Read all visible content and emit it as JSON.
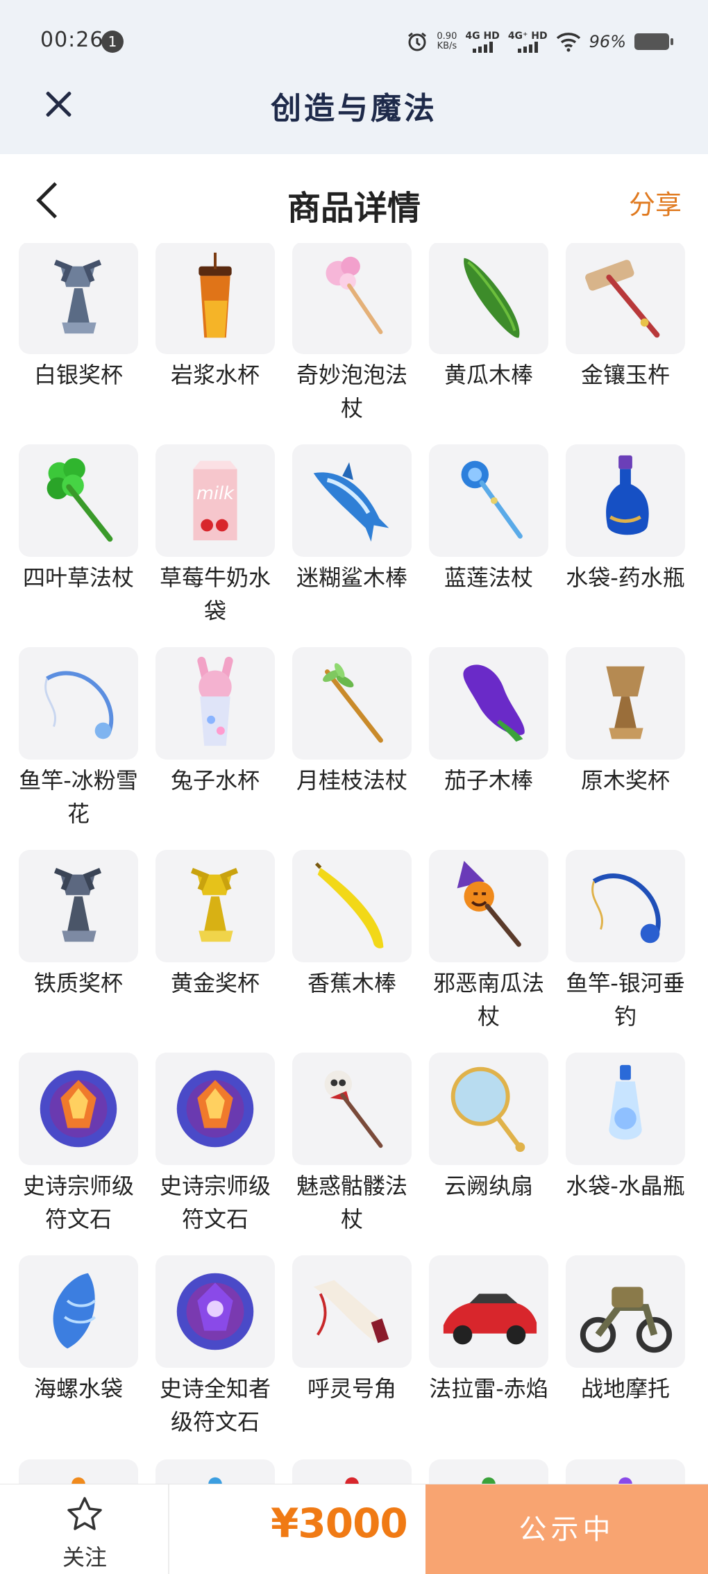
{
  "status_bar": {
    "time": "00:26",
    "notification_count": "1",
    "net_speed_value": "0.90",
    "net_speed_unit": "KB/s",
    "sim1": "4G HD",
    "sim2": "4G⁺ HD",
    "battery": "96%"
  },
  "app": {
    "title": "创造与魔法"
  },
  "header": {
    "title": "商品详情",
    "share_label": "分享"
  },
  "items": [
    {
      "name": "白银奖杯",
      "icon": "trophy-silver"
    },
    {
      "name": "岩浆水杯",
      "icon": "cup-lava"
    },
    {
      "name": "奇妙泡泡法杖",
      "icon": "wand-bubble"
    },
    {
      "name": "黄瓜木棒",
      "icon": "cucumber"
    },
    {
      "name": "金镶玉杵",
      "icon": "hammer"
    },
    {
      "name": "四叶草法杖",
      "icon": "clover-wand"
    },
    {
      "name": "草莓牛奶水袋",
      "icon": "milk-bag"
    },
    {
      "name": "迷糊鲨木棒",
      "icon": "shark"
    },
    {
      "name": "蓝莲法杖",
      "icon": "lotus-wand"
    },
    {
      "name": "水袋-药水瓶",
      "icon": "potion-blue"
    },
    {
      "name": "鱼竿-冰粉雪花",
      "icon": "rod-ice"
    },
    {
      "name": "兔子水杯",
      "icon": "cup-rabbit"
    },
    {
      "name": "月桂枝法杖",
      "icon": "laurel-wand"
    },
    {
      "name": "茄子木棒",
      "icon": "eggplant"
    },
    {
      "name": "原木奖杯",
      "icon": "trophy-wood"
    },
    {
      "name": "铁质奖杯",
      "icon": "trophy-iron"
    },
    {
      "name": "黄金奖杯",
      "icon": "trophy-gold"
    },
    {
      "name": "香蕉木棒",
      "icon": "banana"
    },
    {
      "name": "邪恶南瓜法杖",
      "icon": "pumpkin-wand"
    },
    {
      "name": "鱼竿-银河垂钓",
      "icon": "rod-galaxy"
    },
    {
      "name": "史诗宗师级符文石",
      "icon": "rune-orange"
    },
    {
      "name": "史诗宗师级符文石",
      "icon": "rune-orange"
    },
    {
      "name": "魅惑骷髅法杖",
      "icon": "skull-wand"
    },
    {
      "name": "云阙纨扇",
      "icon": "fan"
    },
    {
      "name": "水袋-水晶瓶",
      "icon": "crystal-bottle"
    },
    {
      "name": "海螺水袋",
      "icon": "conch"
    },
    {
      "name": "史诗全知者级符文石",
      "icon": "rune-purple"
    },
    {
      "name": "呼灵号角",
      "icon": "horn"
    },
    {
      "name": "法拉雷-赤焰",
      "icon": "car-red"
    },
    {
      "name": "战地摩托",
      "icon": "motorbike"
    }
  ],
  "bottom": {
    "follow_label": "关注",
    "price": "¥3000",
    "status_label": "公示中"
  }
}
